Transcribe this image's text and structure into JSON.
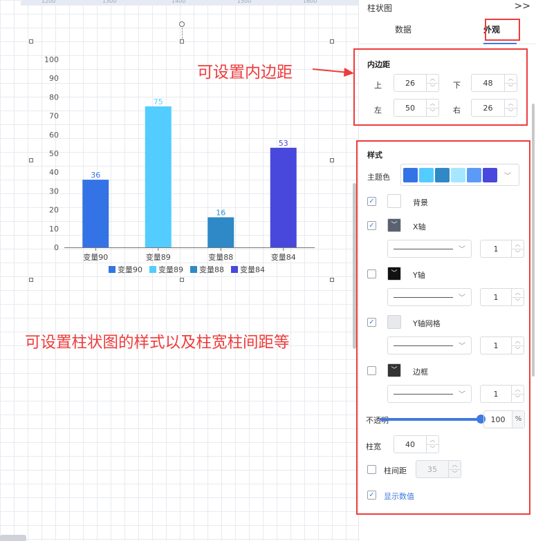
{
  "canvas": {
    "ruler_ticks": [
      "1200",
      "1300",
      "1400",
      "1500",
      "1600"
    ],
    "annotations": {
      "padding_note": "可设置内边距",
      "style_note": "可设置柱状图的样式以及柱宽柱间距等"
    }
  },
  "chart_data": {
    "type": "bar",
    "categories": [
      "变量90",
      "变量89",
      "变量88",
      "变量84"
    ],
    "values": [
      36,
      75,
      16,
      53
    ],
    "colors": [
      "#3473e6",
      "#53ccff",
      "#2e89c6",
      "#4848dc"
    ],
    "ylim": [
      0,
      100
    ],
    "yticks": [
      "0",
      "10",
      "20",
      "30",
      "40",
      "50",
      "60",
      "70",
      "80",
      "90",
      "100"
    ],
    "legend": [
      "变量90",
      "变量89",
      "变量88",
      "变量84"
    ],
    "legend_position": "bottom",
    "show_values": true,
    "grid": false
  },
  "panel": {
    "title": "柱状图",
    "collapse_icon": "double-chevron-right-icon",
    "tabs": [
      "数据",
      "外观"
    ],
    "active_tab": "外观",
    "padding": {
      "title": "内边距",
      "top_label": "上",
      "top": "26",
      "bottom_label": "下",
      "bottom": "48",
      "left_label": "左",
      "left": "50",
      "right_label": "右",
      "right": "26"
    },
    "style": {
      "title": "样式",
      "theme_label": "主题色",
      "theme_colors": [
        "#3473e6",
        "#53ccff",
        "#2e89c6",
        "#a6e6ff",
        "#5b9bf7",
        "#4848dc"
      ],
      "background_label": "背景",
      "x_axis_label": "X轴",
      "x_axis_width": "1",
      "y_axis_label": "Y轴",
      "y_axis_width": "1",
      "y_grid_label": "Y轴网格",
      "y_grid_width": "1",
      "border_label": "边框",
      "border_width": "1",
      "opacity_label": "不透明",
      "opacity": "100",
      "opacity_unit": "%",
      "bar_width_label": "柱宽",
      "bar_width": "40",
      "bar_gap_label": "柱间距",
      "bar_gap": "35",
      "show_values_label": "显示数值"
    }
  }
}
